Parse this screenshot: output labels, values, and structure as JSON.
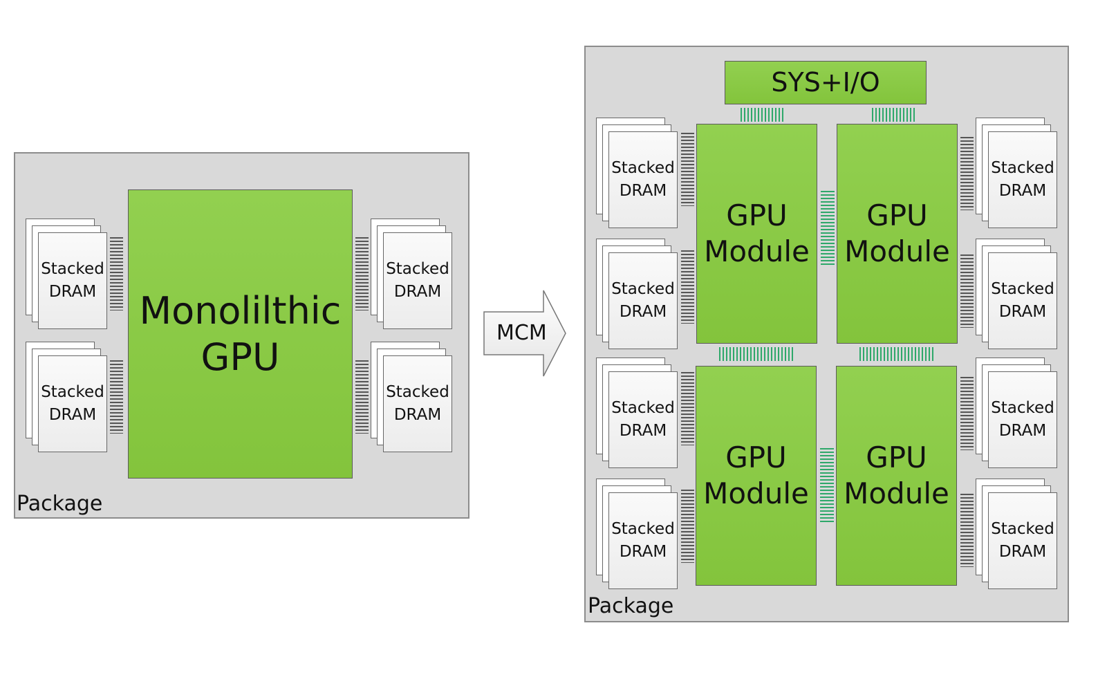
{
  "left_package": {
    "label": "Package",
    "gpu_line1": "Monolilthic",
    "gpu_line2": "GPU",
    "dram": [
      {
        "line1": "Stacked",
        "line2": "DRAM"
      },
      {
        "line1": "Stacked",
        "line2": "DRAM"
      },
      {
        "line1": "Stacked",
        "line2": "DRAM"
      },
      {
        "line1": "Stacked",
        "line2": "DRAM"
      }
    ]
  },
  "arrow": {
    "label": "MCM"
  },
  "right_package": {
    "label": "Package",
    "sys_io": "SYS+I/O",
    "modules": [
      {
        "line1": "GPU",
        "line2": "Module"
      },
      {
        "line1": "GPU",
        "line2": "Module"
      },
      {
        "line1": "GPU",
        "line2": "Module"
      },
      {
        "line1": "GPU",
        "line2": "Module"
      }
    ],
    "dram": [
      {
        "line1": "Stacked",
        "line2": "DRAM"
      },
      {
        "line1": "Stacked",
        "line2": "DRAM"
      },
      {
        "line1": "Stacked",
        "line2": "DRAM"
      },
      {
        "line1": "Stacked",
        "line2": "DRAM"
      },
      {
        "line1": "Stacked",
        "line2": "DRAM"
      },
      {
        "line1": "Stacked",
        "line2": "DRAM"
      },
      {
        "line1": "Stacked",
        "line2": "DRAM"
      },
      {
        "line1": "Stacked",
        "line2": "DRAM"
      }
    ]
  },
  "colors": {
    "gpu_green": "#92d050",
    "package_gray": "#d9d9d9",
    "link_green": "#2ea86a"
  }
}
